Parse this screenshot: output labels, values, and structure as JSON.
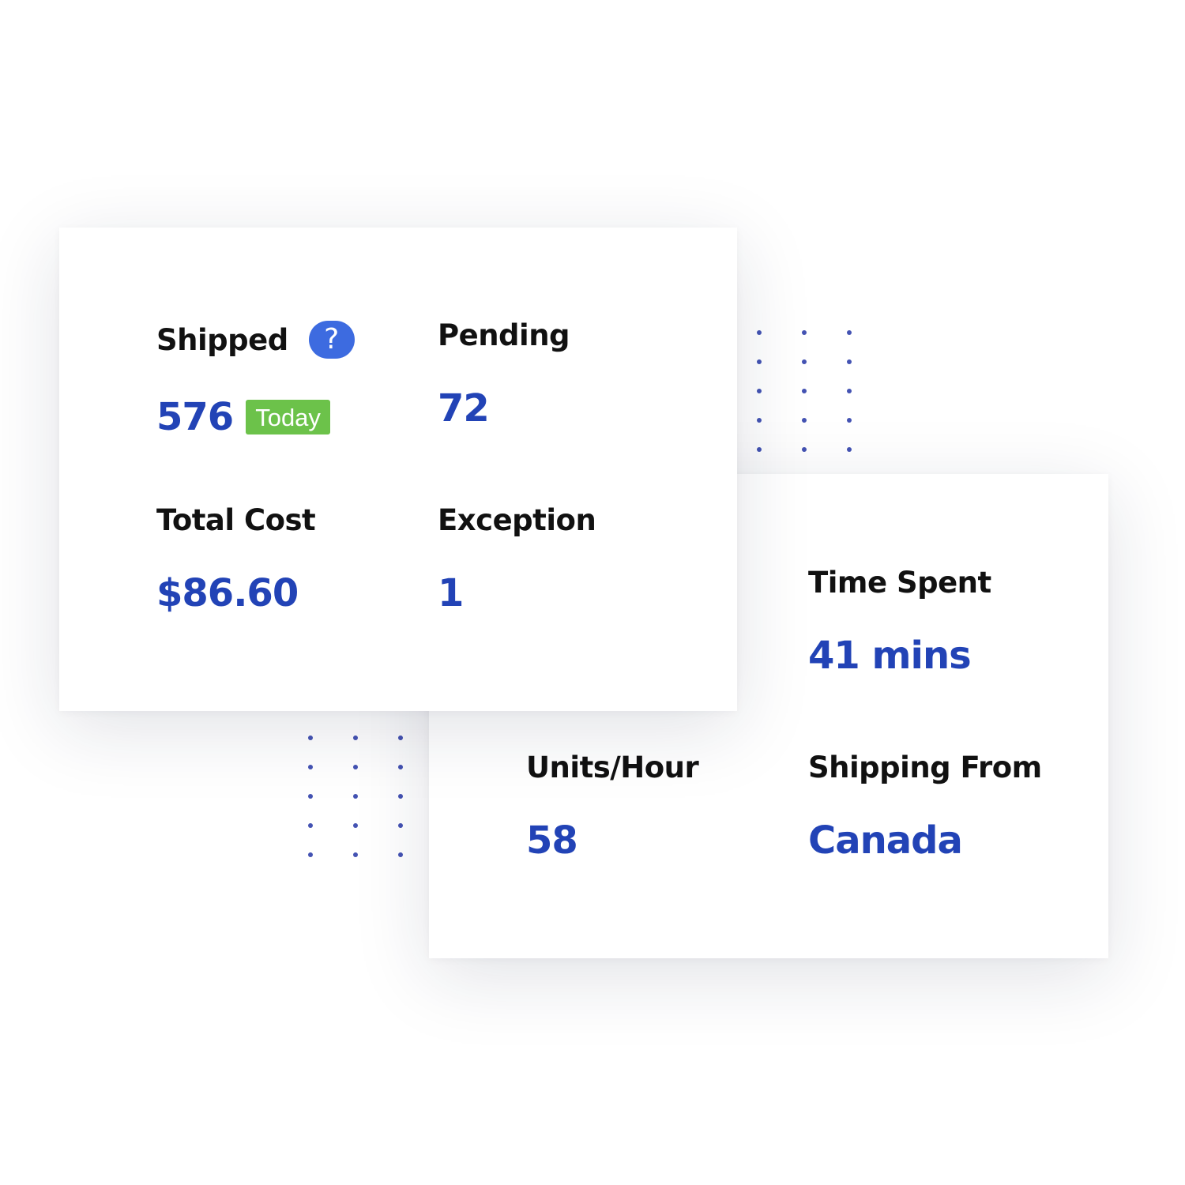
{
  "colors": {
    "accent_value": "#2243b6",
    "label": "#111111",
    "help_icon": "#3d6be0",
    "badge_today": "#6cc24a",
    "dots": "#4453b3"
  },
  "summary_card": {
    "shipped": {
      "label": "Shipped",
      "help_icon": "?",
      "value": "576",
      "badge": "Today"
    },
    "pending": {
      "label": "Pending",
      "value": "72"
    },
    "total_cost": {
      "label": "Total Cost",
      "value": "$86.60"
    },
    "exception": {
      "label": "Exception",
      "value": "1"
    }
  },
  "details_card": {
    "time_spent": {
      "label": "Time Spent",
      "value": "41 mins"
    },
    "units_per_hour": {
      "label": "Units/Hour",
      "value": "58"
    },
    "shipping_from": {
      "label": "Shipping From",
      "value": "Canada"
    }
  }
}
